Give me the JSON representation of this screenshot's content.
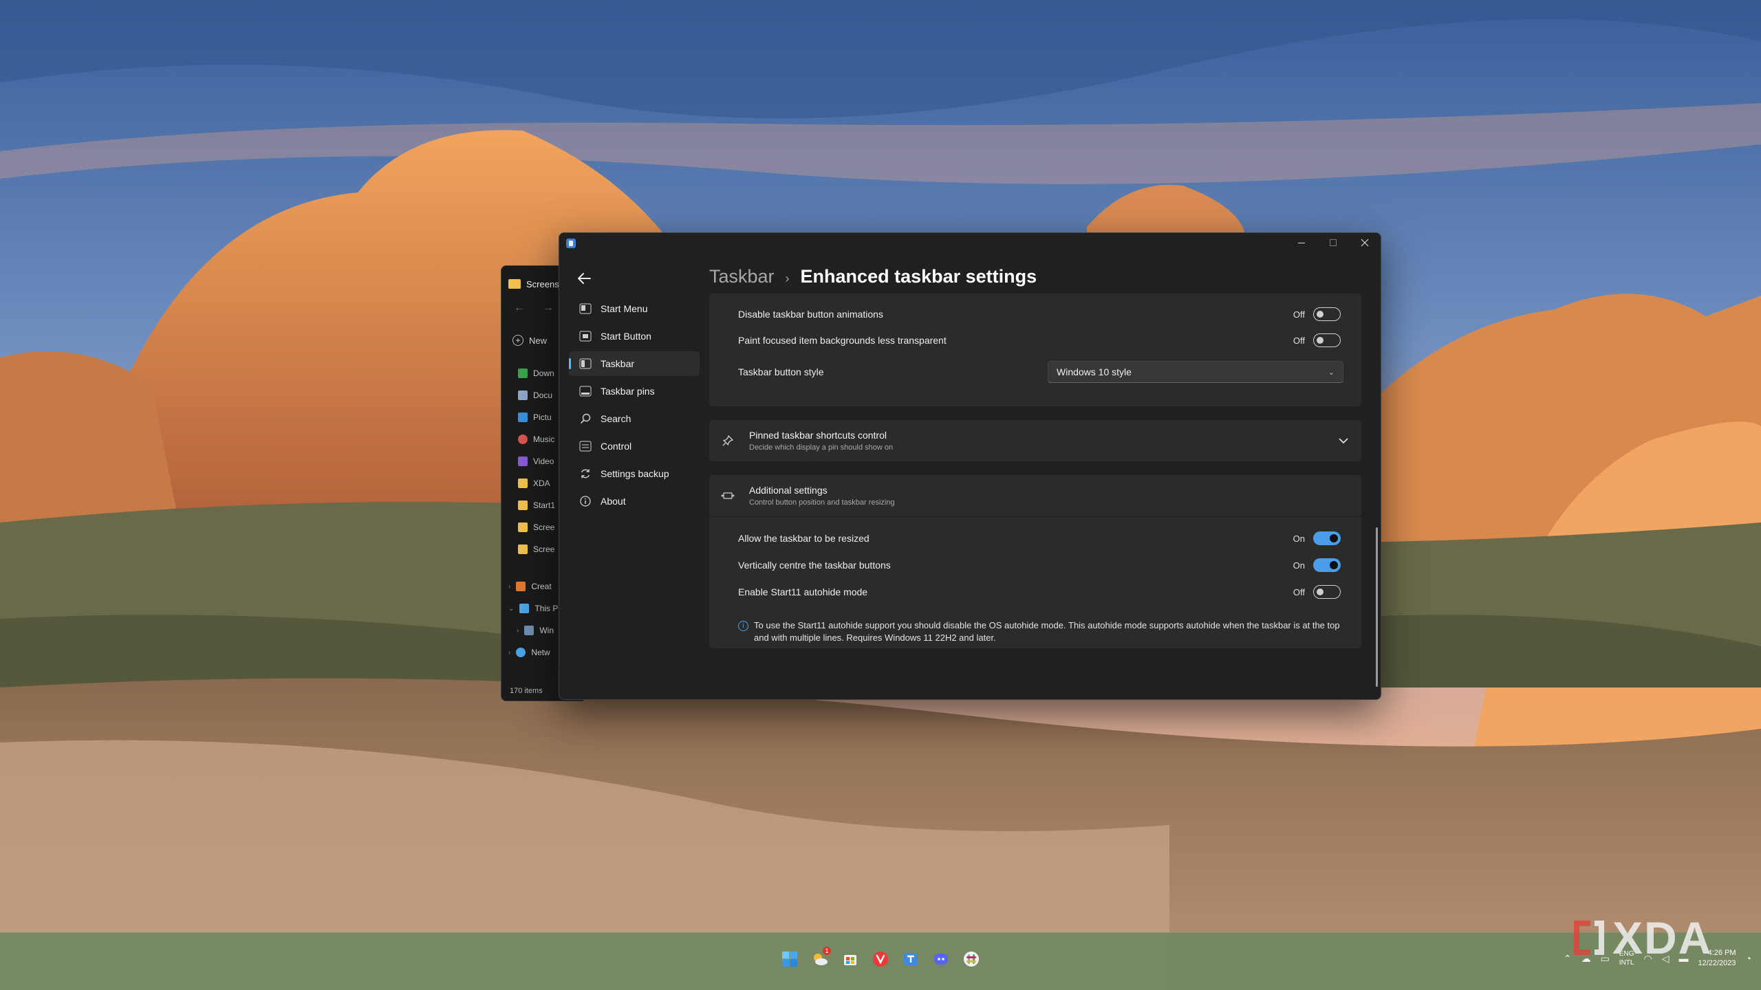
{
  "window": {
    "breadcrumb_parent": "Taskbar",
    "breadcrumb_separator": "›",
    "breadcrumb_current": "Enhanced taskbar settings"
  },
  "nav": {
    "items": [
      {
        "label": "Start Menu",
        "icon": "start-menu-icon"
      },
      {
        "label": "Start Button",
        "icon": "start-button-icon"
      },
      {
        "label": "Taskbar",
        "icon": "taskbar-icon",
        "active": true
      },
      {
        "label": "Taskbar pins",
        "icon": "taskbar-pins-icon"
      },
      {
        "label": "Search",
        "icon": "search-icon"
      },
      {
        "label": "Control",
        "icon": "control-icon"
      },
      {
        "label": "Settings backup",
        "icon": "sync-icon"
      },
      {
        "label": "About",
        "icon": "info-icon"
      }
    ]
  },
  "settings": {
    "card1": {
      "rows": [
        {
          "label": "Disable taskbar button animations",
          "state": "Off"
        },
        {
          "label": "Paint focused item backgrounds less transparent",
          "state": "Off"
        }
      ],
      "button_style_label": "Taskbar button style",
      "button_style_value": "Windows 10 style"
    },
    "pinned": {
      "title": "Pinned taskbar shortcuts control",
      "subtitle": "Decide which display a pin should show on"
    },
    "additional": {
      "title": "Additional settings",
      "subtitle": "Control button position and taskbar resizing",
      "rows": [
        {
          "label": "Allow the taskbar to be resized",
          "state": "On"
        },
        {
          "label": "Vertically centre the taskbar buttons",
          "state": "On"
        },
        {
          "label": "Enable Start11 autohide mode",
          "state": "Off"
        }
      ],
      "info_text": "To use the Start11 autohide support you should disable the OS autohide mode.  This autohide mode supports autohide when the taskbar is at the top and with multiple lines.  Requires Windows 11 22H2 and later."
    }
  },
  "explorer": {
    "tab_title": "Screens",
    "new_label": "New",
    "items": [
      "Down",
      "Docu",
      "Pictu",
      "Music",
      "Video",
      "XDA",
      "Start1",
      "Scree",
      "Scree"
    ],
    "tree": [
      "Creat",
      "This P",
      "Win",
      "Netw"
    ],
    "status": "170 items"
  },
  "taskbar": {
    "apps": [
      "windows-start-icon",
      "weather-widget-icon",
      "store-icon",
      "vivaldi-icon",
      "teams-icon",
      "discord-icon",
      "slack-icon"
    ],
    "weather_badge": "1",
    "lang_line1": "ENG",
    "lang_line2": "INTL",
    "time": "4:26 PM",
    "date": "12/22/2023"
  },
  "watermark": {
    "text": "XDA"
  },
  "colors": {
    "accent": "#4a9de8",
    "window_bg": "#202020",
    "card_bg": "#2b2b2b"
  }
}
